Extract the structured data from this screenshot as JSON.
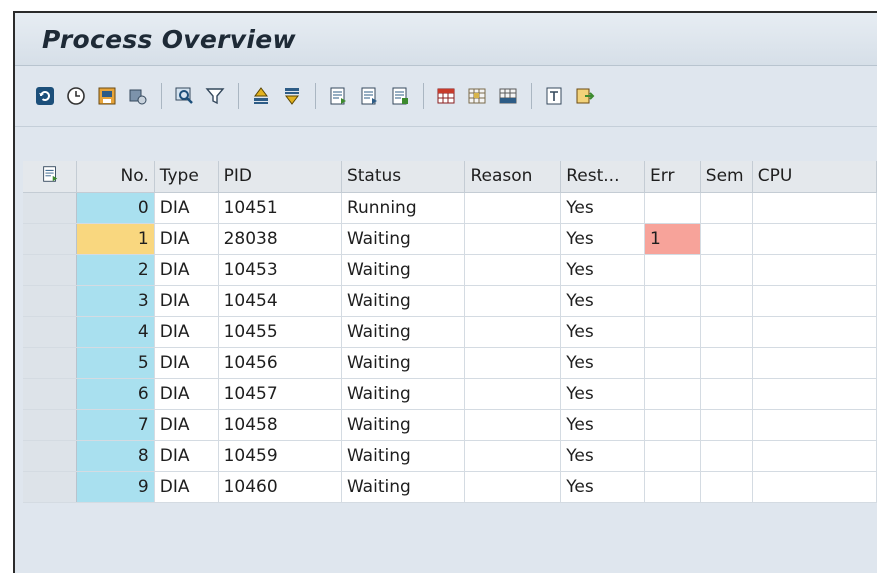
{
  "window": {
    "title": "Process Overview"
  },
  "toolbar": {
    "icons": [
      "refresh-icon",
      "clock-icon",
      "save-layout-icon",
      "settings-icon",
      "find-icon",
      "filter-icon",
      "sort-ascending-icon",
      "sort-descending-icon",
      "details-icon",
      "details-alt-icon",
      "details-export-icon",
      "grid-icon",
      "grid-edit-icon",
      "grid-select-icon",
      "spreadsheet-icon",
      "export-icon"
    ]
  },
  "table": {
    "columns": [
      "No.",
      "Type",
      "PID",
      "Status",
      "Reason",
      "Rest...",
      "Err",
      "Sem",
      "CPU"
    ],
    "rows": [
      {
        "no": "0",
        "type": "DIA",
        "pid": "10451",
        "status": "Running",
        "reason": "",
        "rest": "Yes",
        "err": "",
        "sem": "",
        "cpu": ""
      },
      {
        "no": "1",
        "type": "DIA",
        "pid": "28038",
        "status": "Waiting",
        "reason": "",
        "rest": "Yes",
        "err": "1",
        "sem": "",
        "cpu": ""
      },
      {
        "no": "2",
        "type": "DIA",
        "pid": "10453",
        "status": "Waiting",
        "reason": "",
        "rest": "Yes",
        "err": "",
        "sem": "",
        "cpu": ""
      },
      {
        "no": "3",
        "type": "DIA",
        "pid": "10454",
        "status": "Waiting",
        "reason": "",
        "rest": "Yes",
        "err": "",
        "sem": "",
        "cpu": ""
      },
      {
        "no": "4",
        "type": "DIA",
        "pid": "10455",
        "status": "Waiting",
        "reason": "",
        "rest": "Yes",
        "err": "",
        "sem": "",
        "cpu": ""
      },
      {
        "no": "5",
        "type": "DIA",
        "pid": "10456",
        "status": "Waiting",
        "reason": "",
        "rest": "Yes",
        "err": "",
        "sem": "",
        "cpu": ""
      },
      {
        "no": "6",
        "type": "DIA",
        "pid": "10457",
        "status": "Waiting",
        "reason": "",
        "rest": "Yes",
        "err": "",
        "sem": "",
        "cpu": ""
      },
      {
        "no": "7",
        "type": "DIA",
        "pid": "10458",
        "status": "Waiting",
        "reason": "",
        "rest": "Yes",
        "err": "",
        "sem": "",
        "cpu": ""
      },
      {
        "no": "8",
        "type": "DIA",
        "pid": "10459",
        "status": "Waiting",
        "reason": "",
        "rest": "Yes",
        "err": "",
        "sem": "",
        "cpu": ""
      },
      {
        "no": "9",
        "type": "DIA",
        "pid": "10460",
        "status": "Waiting",
        "reason": "",
        "rest": "Yes",
        "err": "",
        "sem": "",
        "cpu": ""
      }
    ]
  },
  "colors": {
    "no_cell": "#a9e0ef",
    "selected_no_cell": "#f9d77f",
    "error_cell": "#f7a39a"
  }
}
